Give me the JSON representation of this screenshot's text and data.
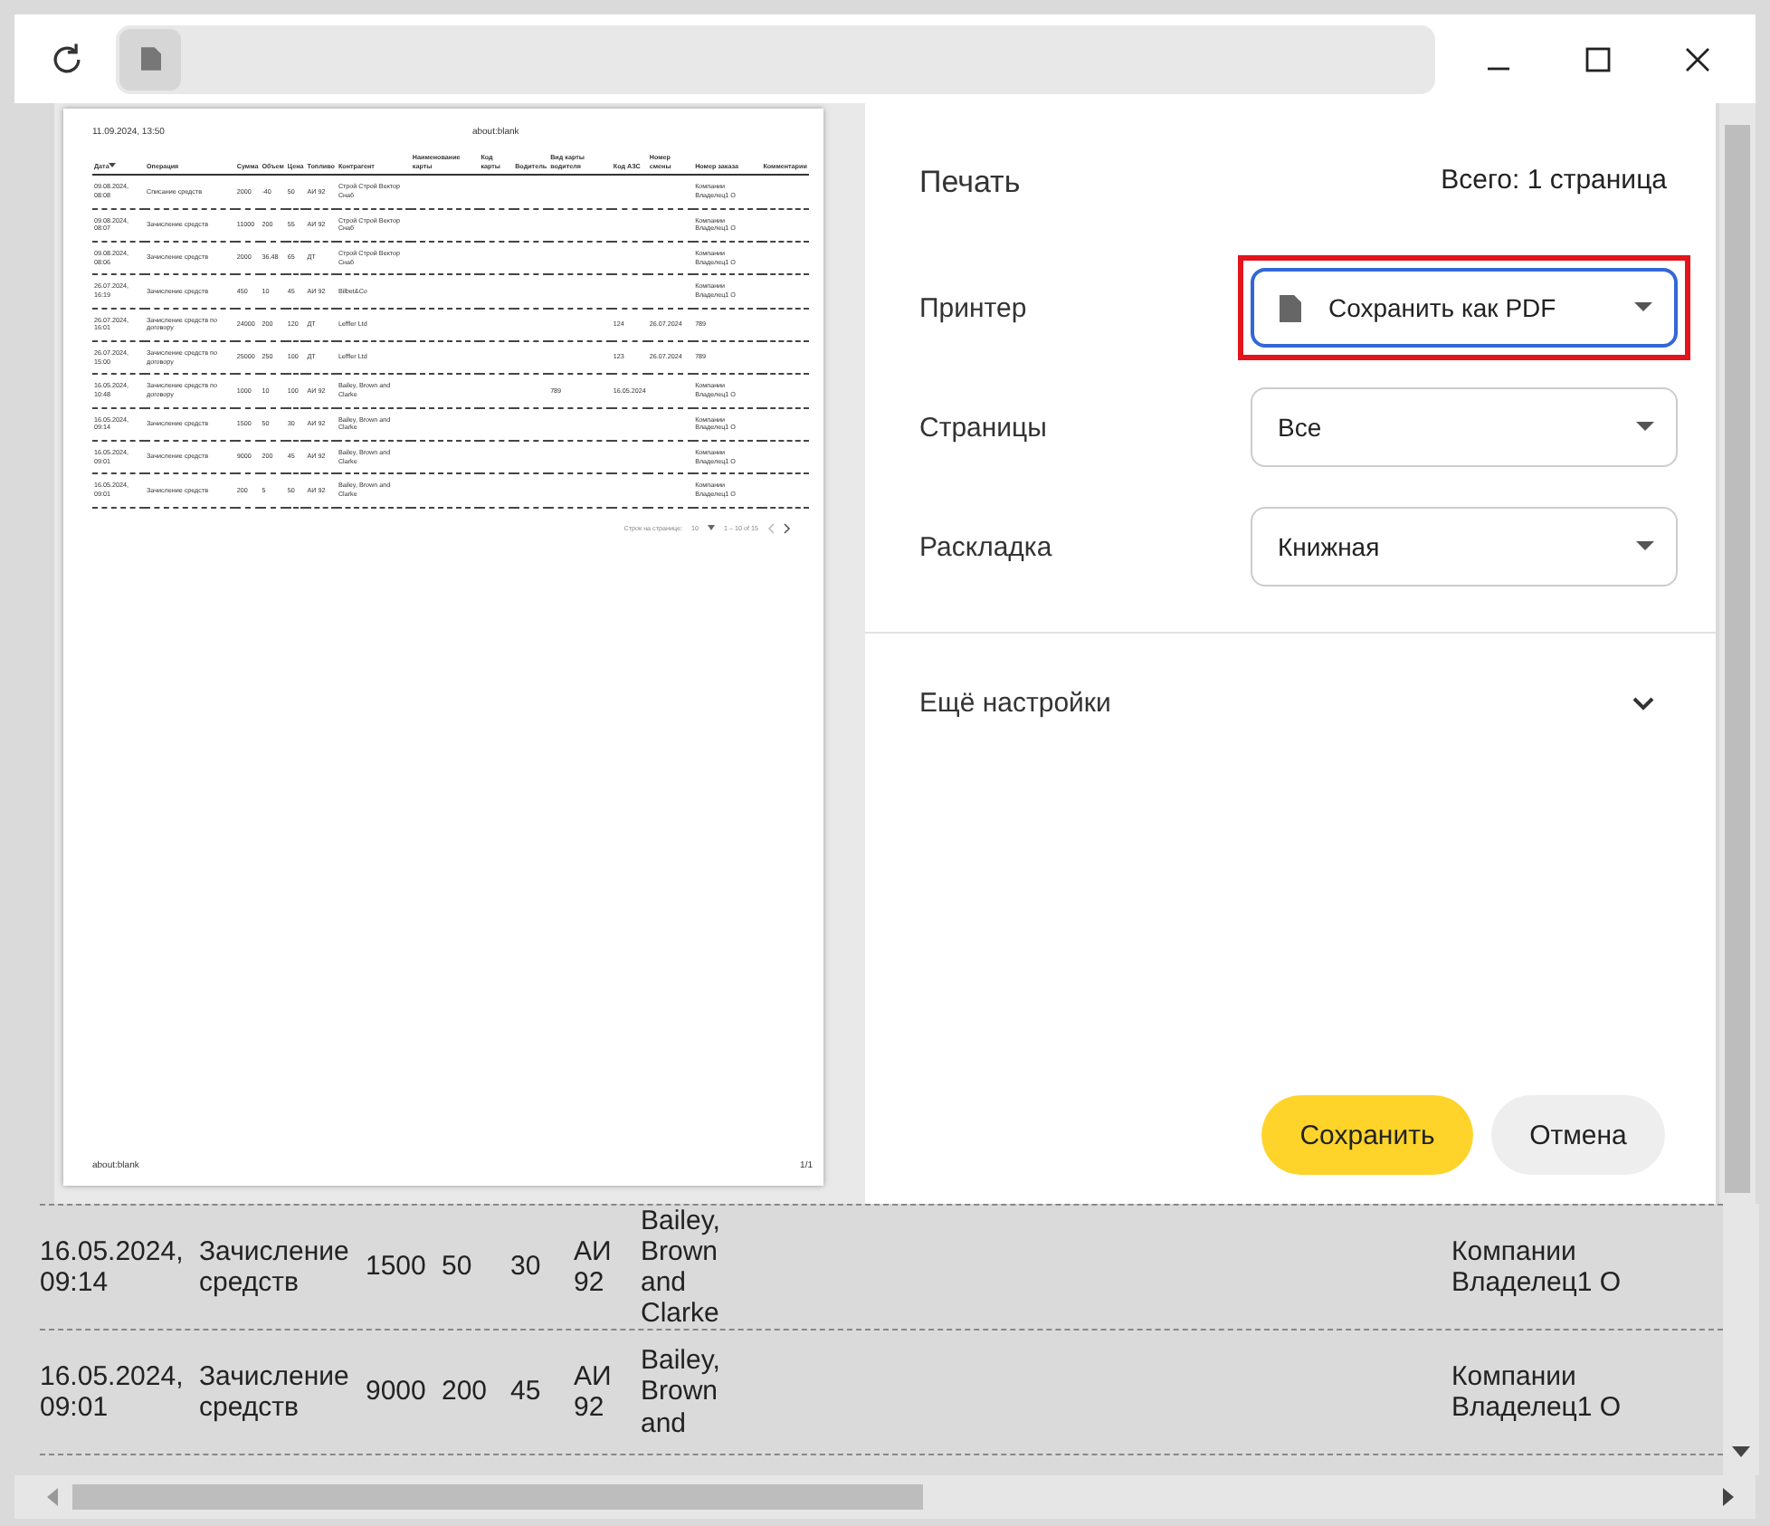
{
  "preview": {
    "header_left": "11.09.2024, 13:50",
    "header_title": "about:blank",
    "columns": [
      {
        "label": "Дата",
        "sorted": true
      },
      {
        "label": "Операция",
        "sorted": false
      },
      {
        "label": "Сумма",
        "sorted": false
      },
      {
        "label": "Объем",
        "sorted": false
      },
      {
        "label": "Цена",
        "sorted": false
      },
      {
        "label": "Топливо",
        "sorted": false
      },
      {
        "label": "Контрагент",
        "sorted": false
      },
      {
        "label": "Наименование карты",
        "sorted": false
      },
      {
        "label": "Код карты",
        "sorted": false
      },
      {
        "label": "Водитель",
        "sorted": false
      },
      {
        "label": "Вид карты водителя",
        "sorted": false
      },
      {
        "label": "Код АЗС",
        "sorted": false
      },
      {
        "label": "Номер смены",
        "sorted": false
      },
      {
        "label": "Номер заказа",
        "sorted": false
      },
      {
        "label": "Комментарии",
        "sorted": false
      }
    ],
    "rows": [
      [
        "09.08.2024, 08:08",
        "Списание средств",
        "2000",
        "-40",
        "50",
        "АИ 92",
        "Строй Строй Вектор Снаб",
        null,
        null,
        null,
        null,
        null,
        null,
        "Компании Владелец1 О",
        null
      ],
      [
        "09.08.2024, 08:07",
        "Зачисление средств",
        "11000",
        "200",
        "55",
        "АИ 92",
        "Строй Строй Вектор Снаб",
        null,
        null,
        null,
        null,
        null,
        null,
        "Компании Владелец1 О",
        null
      ],
      [
        "09.08.2024, 08:06",
        "Зачисление средств",
        "2000",
        "36.48",
        "65",
        "ДТ",
        "Строй Строй Вектор Снаб",
        null,
        null,
        null,
        null,
        null,
        null,
        "Компании Владелец1 О",
        null
      ],
      [
        "26.07.2024, 16:19",
        "Зачисление средств",
        "450",
        "10",
        "45",
        "АИ 92",
        "Bilbet&Co",
        null,
        null,
        null,
        null,
        null,
        null,
        "Компании Владелец1 О",
        null
      ],
      [
        "26.07.2024, 16:01",
        "Зачисление средств по договору",
        "24000",
        "200",
        "120",
        "ДТ",
        "Leffler Ltd",
        null,
        null,
        null,
        null,
        "124",
        "26.07.2024",
        "789",
        null
      ],
      [
        "26.07.2024, 15:00",
        "Зачисление средств по договору",
        "25000",
        "250",
        "100",
        "ДТ",
        "Leffler Ltd",
        null,
        null,
        null,
        null,
        "123",
        "26.07.2024",
        "789",
        null
      ],
      [
        "16.05.2024, 10:48",
        "Зачисление средств по договору",
        "1000",
        "10",
        "100",
        "АИ 92",
        "Bailey, Brown and Clarke",
        null,
        null,
        null,
        "789",
        "16.05.2024",
        null,
        "Компании Владелец1 О",
        null
      ],
      [
        "16.05.2024, 09:14",
        "Зачисление средств",
        "1500",
        "50",
        "30",
        "АИ 92",
        "Bailey, Brown and Clarke",
        null,
        null,
        null,
        null,
        null,
        null,
        "Компании Владелец1 О",
        null
      ],
      [
        "16.05.2024, 09:01",
        "Зачисление средств",
        "9000",
        "200",
        "45",
        "АИ 92",
        "Bailey, Brown and Clarke",
        null,
        null,
        null,
        null,
        null,
        null,
        "Компании Владелец1 О",
        null
      ],
      [
        "16.05.2024, 09:01",
        "Зачисление средств",
        "200",
        "5",
        "50",
        "АИ 92",
        "Bailey, Brown and Clarke",
        null,
        null,
        null,
        null,
        null,
        null,
        "Компании Владелец1 О",
        null
      ]
    ],
    "rows_per_page_label": "Строк на странице:",
    "rows_per_page": "10",
    "range": "1 – 10 of 15",
    "footer_left": "about:blank",
    "footer_right": "1/1"
  },
  "settings": {
    "title": "Печать",
    "total": "Всего: 1 страница",
    "fields": [
      {
        "label": "Принтер",
        "value": "Сохранить как PDF",
        "kind": "printer",
        "focused": true,
        "highlighted": true
      },
      {
        "label": "Страницы",
        "value": "Все",
        "kind": "plain",
        "focused": false,
        "highlighted": false
      },
      {
        "label": "Раскладка",
        "value": "Книжная",
        "kind": "plain",
        "focused": false,
        "highlighted": false
      }
    ],
    "more": {
      "label": "Ещё настройки",
      "expanded": false
    }
  },
  "buttons": [
    {
      "label": "Сохранить",
      "kind": "primary"
    },
    {
      "label": "Отмена",
      "kind": "secondary"
    }
  ],
  "background_rows": [
    {
      "date": "16.05.2024, 09:14",
      "operation": "Зачисление средств",
      "amount": "1500",
      "volume": "50",
      "price": "30",
      "fuel": "АИ 92",
      "contractor": "Bailey, Brown and Clarke",
      "owner": "Компании Владелец1 О"
    },
    {
      "date": "16.05.2024, 09:01",
      "operation": "Зачисление средств",
      "amount": "9000",
      "volume": "200",
      "price": "45",
      "fuel": "АИ 92",
      "contractor": "Bailey, Brown and",
      "owner": "Компании Владелец1 О"
    }
  ]
}
